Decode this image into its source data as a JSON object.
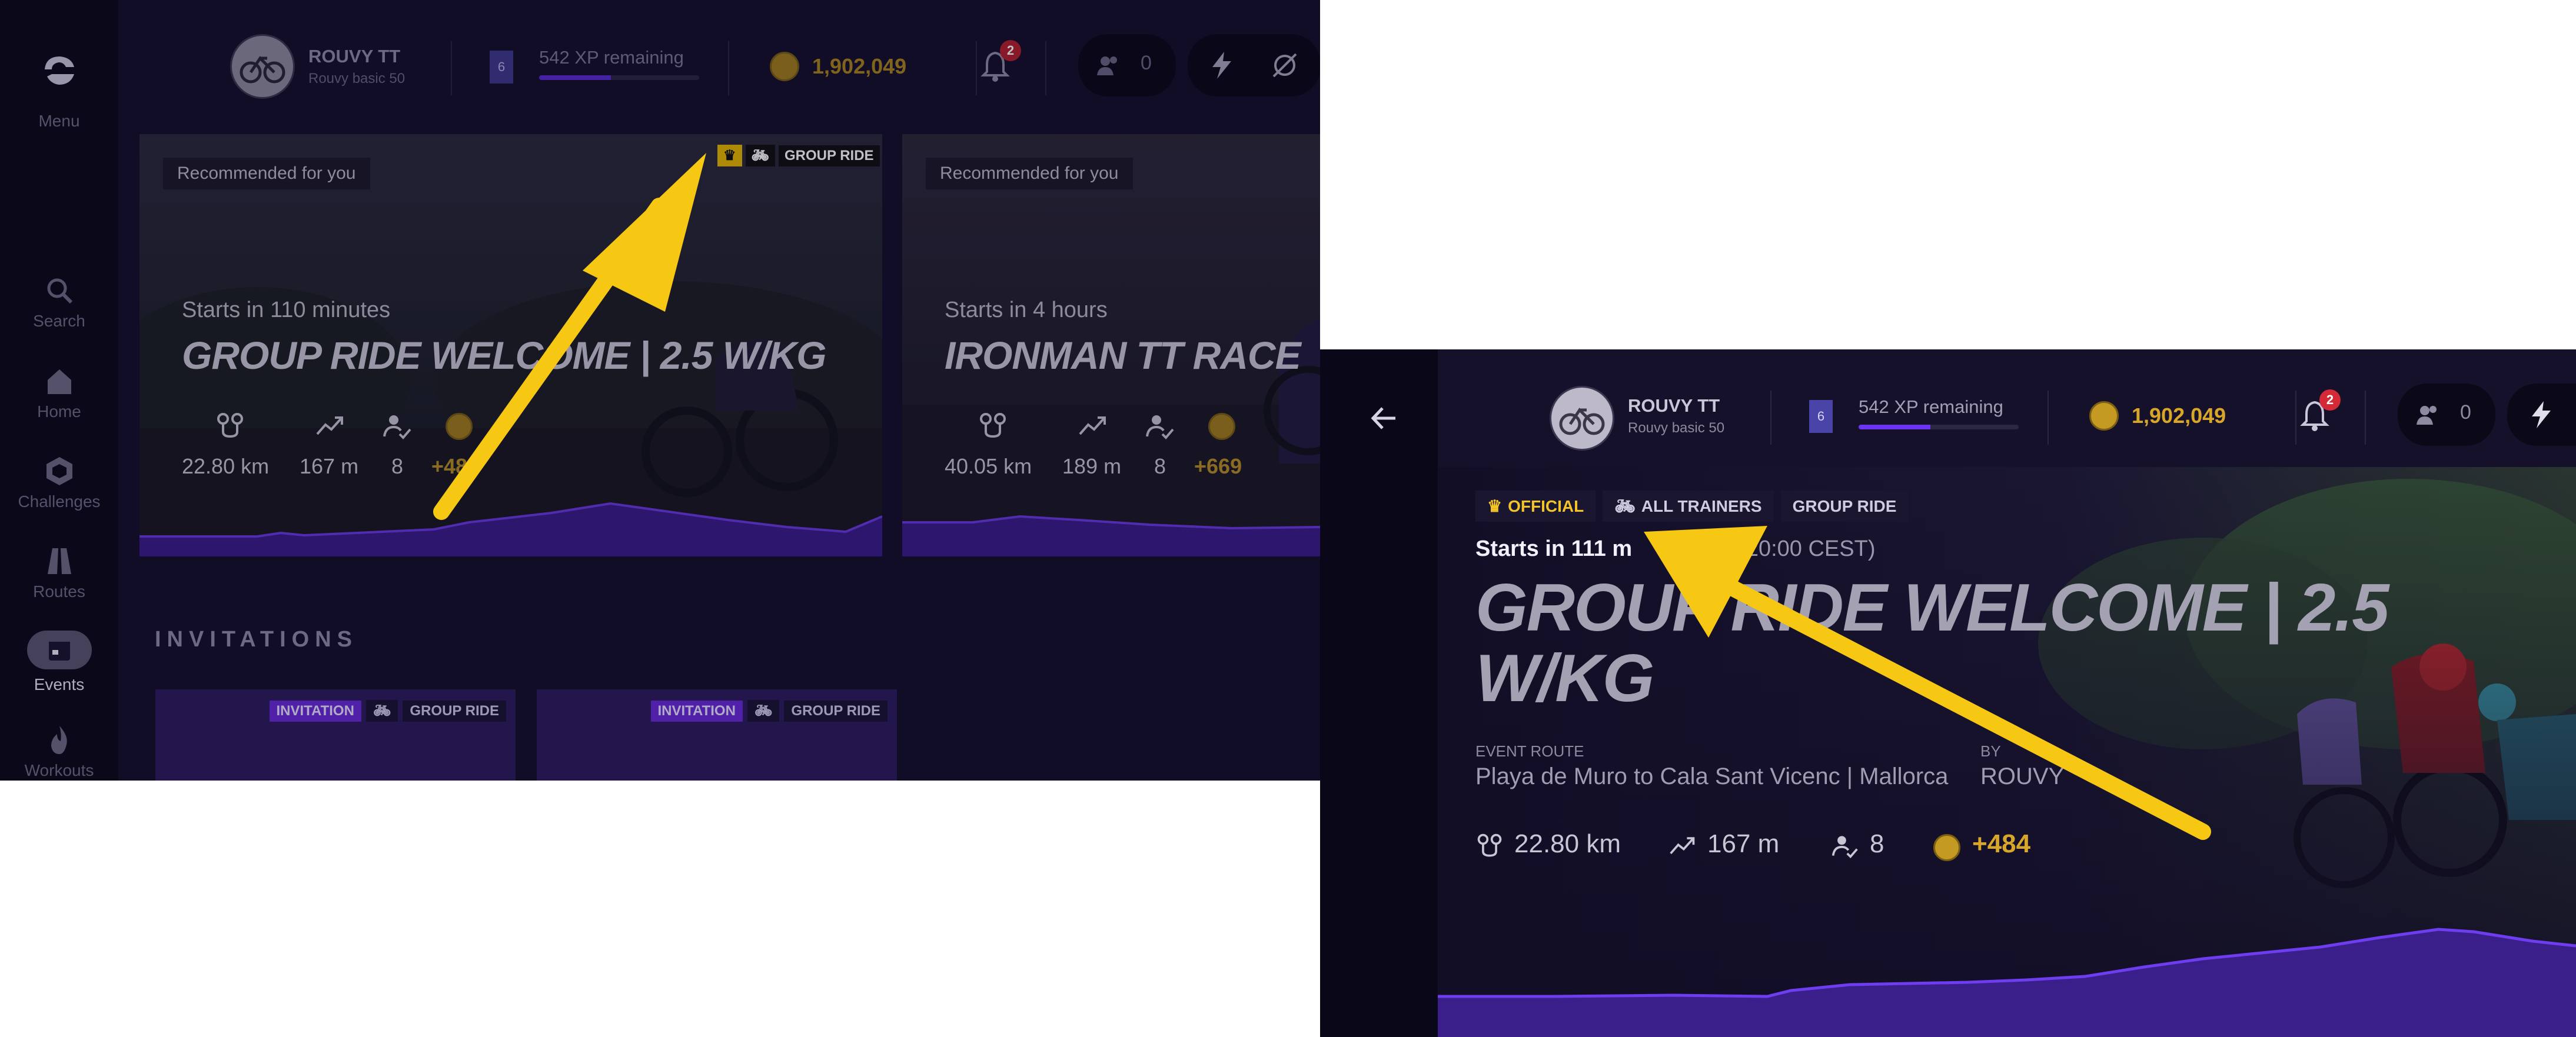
{
  "sidebar": {
    "menu_label": "Menu",
    "items": [
      {
        "label": "Search",
        "icon": "search-icon"
      },
      {
        "label": "Home",
        "icon": "home-icon"
      },
      {
        "label": "Challenges",
        "icon": "hexagon-icon"
      },
      {
        "label": "Routes",
        "icon": "road-icon"
      },
      {
        "label": "Events",
        "icon": "calendar-icon",
        "active": true
      },
      {
        "label": "Workouts",
        "icon": "flame-icon"
      }
    ]
  },
  "topbar": {
    "user_name": "ROUVY TT",
    "user_sub": "Rouvy basic 50",
    "level": "6",
    "xp_text": "542 XP remaining",
    "xp_progress": 0.45,
    "coins": "1,902,049",
    "notifications": "2",
    "friends_count": "0"
  },
  "cards": [
    {
      "tag": "Recommended for you",
      "starts": "Starts in 110 minutes",
      "title": "GROUP RIDE WELCOME | 2.5 W/KG",
      "distance": "22.80 km",
      "elevation": "167 m",
      "riders": "8",
      "coins": "+484",
      "badge_label": "GROUP RIDE"
    },
    {
      "tag": "Recommended for you",
      "starts": "Starts in 4 hours",
      "title": "IRONMAN TT RACE",
      "distance": "40.05 km",
      "elevation": "189 m",
      "riders": "8",
      "coins": "+669"
    }
  ],
  "invitations": {
    "title": "INVITATIONS",
    "items": [
      {
        "badge": "INVITATION",
        "type": "GROUP RIDE"
      },
      {
        "badge": "INVITATION",
        "type": "GROUP RIDE"
      }
    ]
  },
  "detail": {
    "chips": [
      "OFFICIAL",
      "ALL TRAINERS",
      "GROUP RIDE"
    ],
    "starts_bold": "Starts in 111 m",
    "starts_dim": "(13 May 20:00 CEST)",
    "title_line1": "GROUP RIDE WELCOME |  2.5",
    "title_line2": "W/KG",
    "route_label": "EVENT ROUTE",
    "route_value": "Playa de Muro to Cala Sant Vicenc | Mallorca",
    "by_label": "BY",
    "by_value": "ROUVY",
    "distance": "22.80 km",
    "elevation": "167 m",
    "riders": "8",
    "coins": "+484"
  },
  "colors": {
    "accent_purple": "#5a2bd0",
    "coin_gold": "#d8a628",
    "annotation_yellow": "#f6c814"
  }
}
